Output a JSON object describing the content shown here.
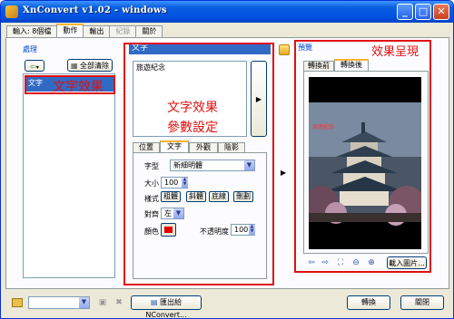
{
  "window": {
    "title": "XnConvert v1.02 - windows"
  },
  "tabs": [
    {
      "label": "輸入: 8個檔"
    },
    {
      "label": "動作"
    },
    {
      "label": "輸出"
    },
    {
      "label": "紀錄"
    },
    {
      "label": "關於"
    }
  ],
  "left": {
    "group_label": "處理",
    "clear_all_label": "全部清除",
    "actions": [
      "文字"
    ],
    "annotation": "文字效果"
  },
  "middle": {
    "header": "文字",
    "text_value": "旅遊紀念",
    "annotation_line1": "文字效果",
    "annotation_line2": "參數設定",
    "subtabs": [
      "位置",
      "文字",
      "外觀",
      "陰影"
    ],
    "font_label": "字型",
    "font_value": "新細明體",
    "size_label": "大小",
    "size_value": "100",
    "style_label": "樣式",
    "style_buttons": [
      "粗體",
      "斜體",
      "底線",
      "刪劃"
    ],
    "align_label": "對齊",
    "align_value": "左",
    "color_label": "顏色",
    "color_value": "#e00000",
    "opacity_label": "不透明度",
    "opacity_value": "100"
  },
  "right": {
    "group_label": "預覽",
    "annotation": "效果呈現",
    "tabs": [
      "轉換前",
      "轉換後"
    ],
    "preview_caption": "旅遊紀念",
    "load_image_label": "載入圖片..."
  },
  "bottom": {
    "export_label": "匯出給NConvert...",
    "convert_label": "轉換",
    "close_label": "關閉"
  }
}
